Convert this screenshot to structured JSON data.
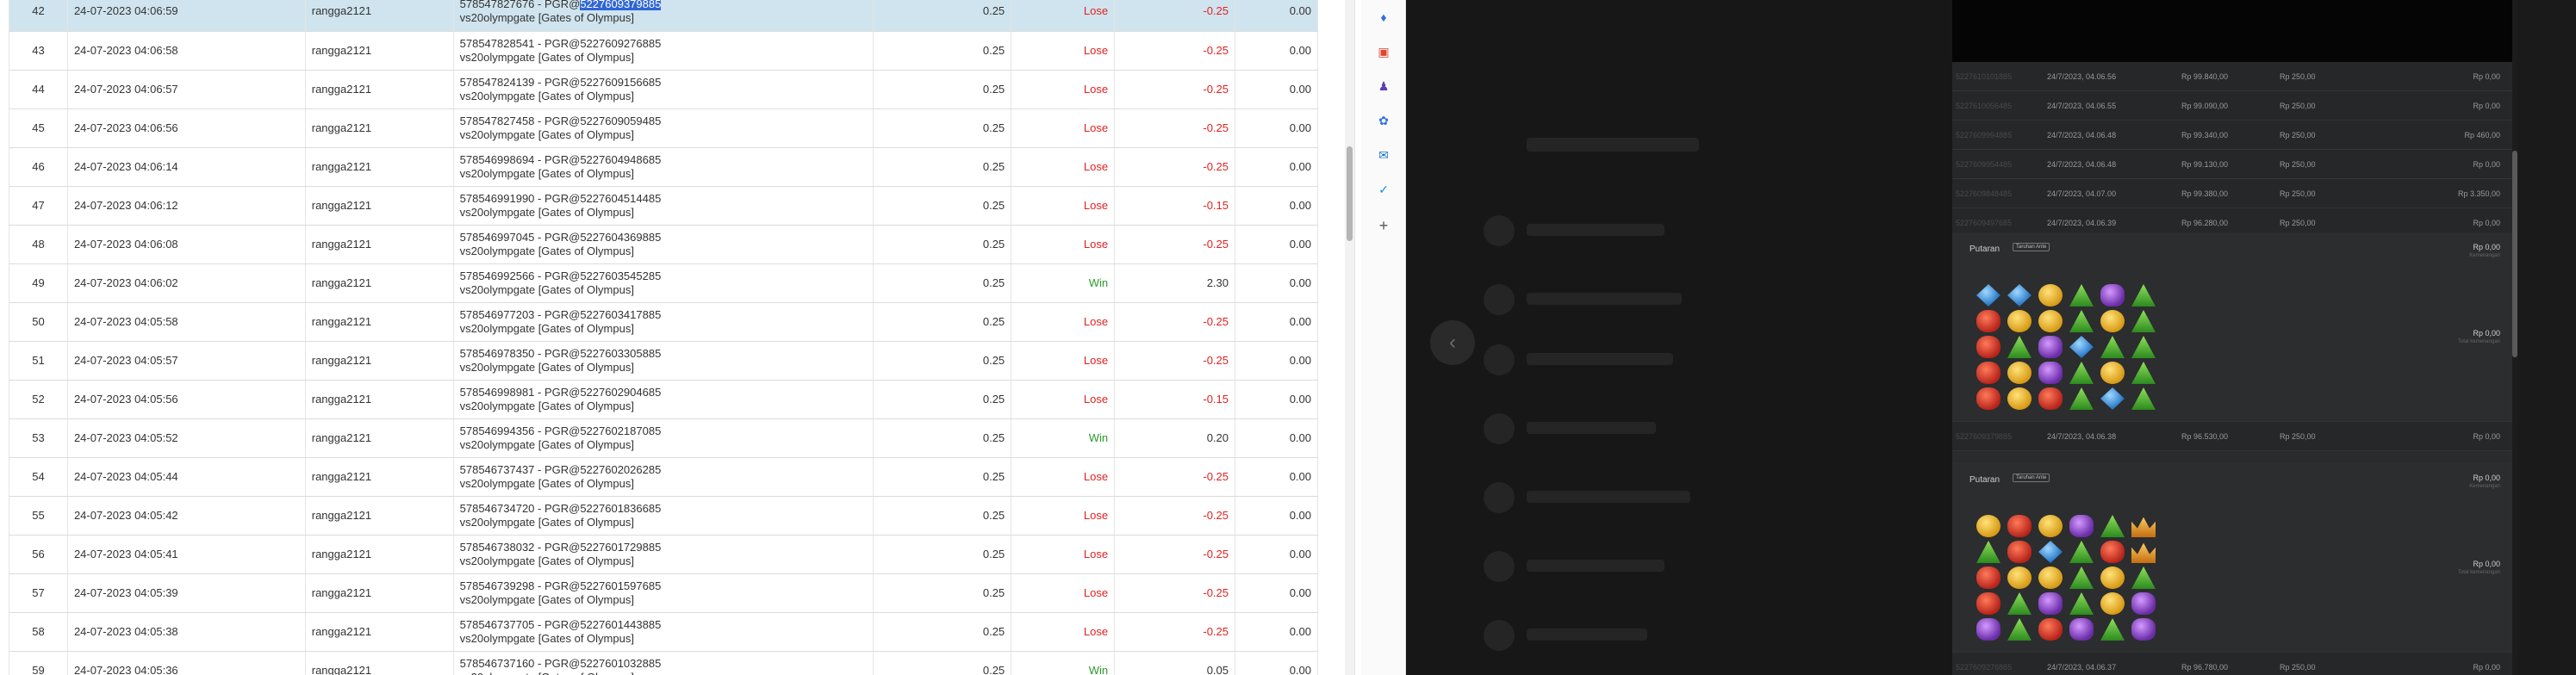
{
  "table": {
    "rows": [
      {
        "no": "42",
        "date": "24-07-2023 04:06:59",
        "user": "rangga2121",
        "txn": "578547827676 - PGR@",
        "txn_hl": "5227609379885",
        "game": "vs20olympgate [Gates of Olympus]",
        "bet": "0.25",
        "result": "Lose",
        "pl": "-0.25",
        "bal": "0.00",
        "selected": true
      },
      {
        "no": "43",
        "date": "24-07-2023 04:06:58",
        "user": "rangga2121",
        "txn": "578547828541 - PGR@5227609276885",
        "txn_hl": "",
        "game": "vs20olympgate [Gates of Olympus]",
        "bet": "0.25",
        "result": "Lose",
        "pl": "-0.25",
        "bal": "0.00"
      },
      {
        "no": "44",
        "date": "24-07-2023 04:06:57",
        "user": "rangga2121",
        "txn": "578547824139 - PGR@5227609156685",
        "txn_hl": "",
        "game": "vs20olympgate [Gates of Olympus]",
        "bet": "0.25",
        "result": "Lose",
        "pl": "-0.25",
        "bal": "0.00"
      },
      {
        "no": "45",
        "date": "24-07-2023 04:06:56",
        "user": "rangga2121",
        "txn": "578547827458 - PGR@5227609059485",
        "txn_hl": "",
        "game": "vs20olympgate [Gates of Olympus]",
        "bet": "0.25",
        "result": "Lose",
        "pl": "-0.25",
        "bal": "0.00"
      },
      {
        "no": "46",
        "date": "24-07-2023 04:06:14",
        "user": "rangga2121",
        "txn": "578546998694 - PGR@5227604948685",
        "txn_hl": "",
        "game": "vs20olympgate [Gates of Olympus]",
        "bet": "0.25",
        "result": "Lose",
        "pl": "-0.25",
        "bal": "0.00"
      },
      {
        "no": "47",
        "date": "24-07-2023 04:06:12",
        "user": "rangga2121",
        "txn": "578546991990 - PGR@5227604514485",
        "txn_hl": "",
        "game": "vs20olympgate [Gates of Olympus]",
        "bet": "0.25",
        "result": "Lose",
        "pl": "-0.15",
        "bal": "0.00"
      },
      {
        "no": "48",
        "date": "24-07-2023 04:06:08",
        "user": "rangga2121",
        "txn": "578546997045 - PGR@5227604369885",
        "txn_hl": "",
        "game": "vs20olympgate [Gates of Olympus]",
        "bet": "0.25",
        "result": "Lose",
        "pl": "-0.25",
        "bal": "0.00"
      },
      {
        "no": "49",
        "date": "24-07-2023 04:06:02",
        "user": "rangga2121",
        "txn": "578546992566 - PGR@5227603545285",
        "txn_hl": "",
        "game": "vs20olympgate [Gates of Olympus]",
        "bet": "0.25",
        "result": "Win",
        "pl": "2.30",
        "bal": "0.00"
      },
      {
        "no": "50",
        "date": "24-07-2023 04:05:58",
        "user": "rangga2121",
        "txn": "578546977203 - PGR@5227603417885",
        "txn_hl": "",
        "game": "vs20olympgate [Gates of Olympus]",
        "bet": "0.25",
        "result": "Lose",
        "pl": "-0.25",
        "bal": "0.00"
      },
      {
        "no": "51",
        "date": "24-07-2023 04:05:57",
        "user": "rangga2121",
        "txn": "578546978350 - PGR@5227603305885",
        "txn_hl": "",
        "game": "vs20olympgate [Gates of Olympus]",
        "bet": "0.25",
        "result": "Lose",
        "pl": "-0.25",
        "bal": "0.00"
      },
      {
        "no": "52",
        "date": "24-07-2023 04:05:56",
        "user": "rangga2121",
        "txn": "578546998981 - PGR@5227602904685",
        "txn_hl": "",
        "game": "vs20olympgate [Gates of Olympus]",
        "bet": "0.25",
        "result": "Lose",
        "pl": "-0.15",
        "bal": "0.00"
      },
      {
        "no": "53",
        "date": "24-07-2023 04:05:52",
        "user": "rangga2121",
        "txn": "578546994356 - PGR@5227602187085",
        "txn_hl": "",
        "game": "vs20olympgate [Gates of Olympus]",
        "bet": "0.25",
        "result": "Win",
        "pl": "0.20",
        "bal": "0.00"
      },
      {
        "no": "54",
        "date": "24-07-2023 04:05:44",
        "user": "rangga2121",
        "txn": "578546737437 - PGR@5227602026285",
        "txn_hl": "",
        "game": "vs20olympgate [Gates of Olympus]",
        "bet": "0.25",
        "result": "Lose",
        "pl": "-0.25",
        "bal": "0.00"
      },
      {
        "no": "55",
        "date": "24-07-2023 04:05:42",
        "user": "rangga2121",
        "txn": "578546734720 - PGR@5227601836685",
        "txn_hl": "",
        "game": "vs20olympgate [Gates of Olympus]",
        "bet": "0.25",
        "result": "Lose",
        "pl": "-0.25",
        "bal": "0.00"
      },
      {
        "no": "56",
        "date": "24-07-2023 04:05:41",
        "user": "rangga2121",
        "txn": "578546738032 - PGR@5227601729885",
        "txn_hl": "",
        "game": "vs20olympgate [Gates of Olympus]",
        "bet": "0.25",
        "result": "Lose",
        "pl": "-0.25",
        "bal": "0.00"
      },
      {
        "no": "57",
        "date": "24-07-2023 04:05:39",
        "user": "rangga2121",
        "txn": "578546739298 - PGR@5227601597685",
        "txn_hl": "",
        "game": "vs20olympgate [Gates of Olympus]",
        "bet": "0.25",
        "result": "Lose",
        "pl": "-0.25",
        "bal": "0.00"
      },
      {
        "no": "58",
        "date": "24-07-2023 04:05:38",
        "user": "rangga2121",
        "txn": "578546737705 - PGR@5227601443885",
        "txn_hl": "",
        "game": "vs20olympgate [Gates of Olympus]",
        "bet": "0.25",
        "result": "Lose",
        "pl": "-0.25",
        "bal": "0.00"
      },
      {
        "no": "59",
        "date": "24-07-2023 04:05:36",
        "user": "rangga2121",
        "txn": "578546737160 - PGR@5227601032885",
        "txn_hl": "",
        "game": "vs20olympgate [Gates of Olympus]",
        "bet": "0.25",
        "result": "Win",
        "pl": "0.05",
        "bal": "0.00"
      }
    ]
  },
  "sidebar_icons": [
    "tag-icon",
    "shopping-icon",
    "games-icon",
    "rainbow-ring-icon",
    "outlook-icon",
    "cart-icon",
    "plus-icon"
  ],
  "history": {
    "rows_top": [
      {
        "id": "5227610101885",
        "date": "24/7/2023, 04.06.56",
        "saldo": "Rp 99.840,00",
        "bet": "Rp 250,00",
        "win": "Rp 0,00"
      },
      {
        "id": "5227610056485",
        "date": "24/7/2023, 04.06.55",
        "saldo": "Rp 99.090,00",
        "bet": "Rp 250,00",
        "win": "Rp 0,00"
      },
      {
        "id": "5227609994885",
        "date": "24/7/2023, 04.06.48",
        "saldo": "Rp 99.340,00",
        "bet": "Rp 250,00",
        "win": "Rp 460,00"
      },
      {
        "id": "5227609954485",
        "date": "24/7/2023, 04.06.48",
        "saldo": "Rp 99.130,00",
        "bet": "Rp 250,00",
        "win": "Rp 0,00"
      },
      {
        "id": "5227609848485",
        "date": "24/7/2023, 04.07.00",
        "saldo": "Rp 99.380,00",
        "bet": "Rp 250,00",
        "win": "Rp 3.350,00"
      },
      {
        "id": "5227609497685",
        "date": "24/7/2023, 04.06.39",
        "saldo": "Rp 96.280,00",
        "bet": "Rp 250,00",
        "win": "Rp 0,00"
      }
    ],
    "spin1": {
      "label": "Putaran",
      "tag": "Taruhan Ante",
      "amt1": "Rp 0,00",
      "sub1": "Kemenangan",
      "amt2": "Rp 0,00",
      "sub2": "Total kemenangan"
    },
    "mid_row": {
      "id": "5227609379885",
      "date": "24/7/2023, 04.06.38",
      "saldo": "Rp 96.530,00",
      "bet": "Rp 250,00",
      "win": "Rp 0,00"
    },
    "spin2": {
      "label": "Putaran",
      "tag": "Taruhan Ante",
      "amt1": "Rp 0,00",
      "sub1": "Kemenangan",
      "amt2": "Rp 0,00",
      "sub2": "Total kemenangan"
    },
    "bottom_row": {
      "id": "5227609276885",
      "date": "24/7/2023, 04.06.37",
      "saldo": "Rp 96.780,00",
      "bet": "Rp 250,00",
      "win": "Rp 0,00"
    }
  },
  "grid1": [
    "blu",
    "blu",
    "yel",
    "grn",
    "pur",
    "grn",
    "red",
    "yel",
    "yel",
    "grn",
    "yel",
    "grn",
    "red",
    "grn",
    "pur",
    "blu",
    "grn",
    "grn",
    "red",
    "yel",
    "pur",
    "grn",
    "yel",
    "grn",
    "red",
    "yel",
    "red",
    "grn",
    "blu",
    "grn"
  ],
  "grid2": [
    "yel",
    "red",
    "yel",
    "pur",
    "grn",
    "crn",
    "grn",
    "red",
    "blu",
    "grn",
    "red",
    "crn",
    "red",
    "yel",
    "yel",
    "grn",
    "yel",
    "grn",
    "red",
    "grn",
    "pur",
    "grn",
    "yel",
    "pur",
    "pur",
    "grn",
    "red",
    "pur",
    "grn",
    "pur"
  ]
}
